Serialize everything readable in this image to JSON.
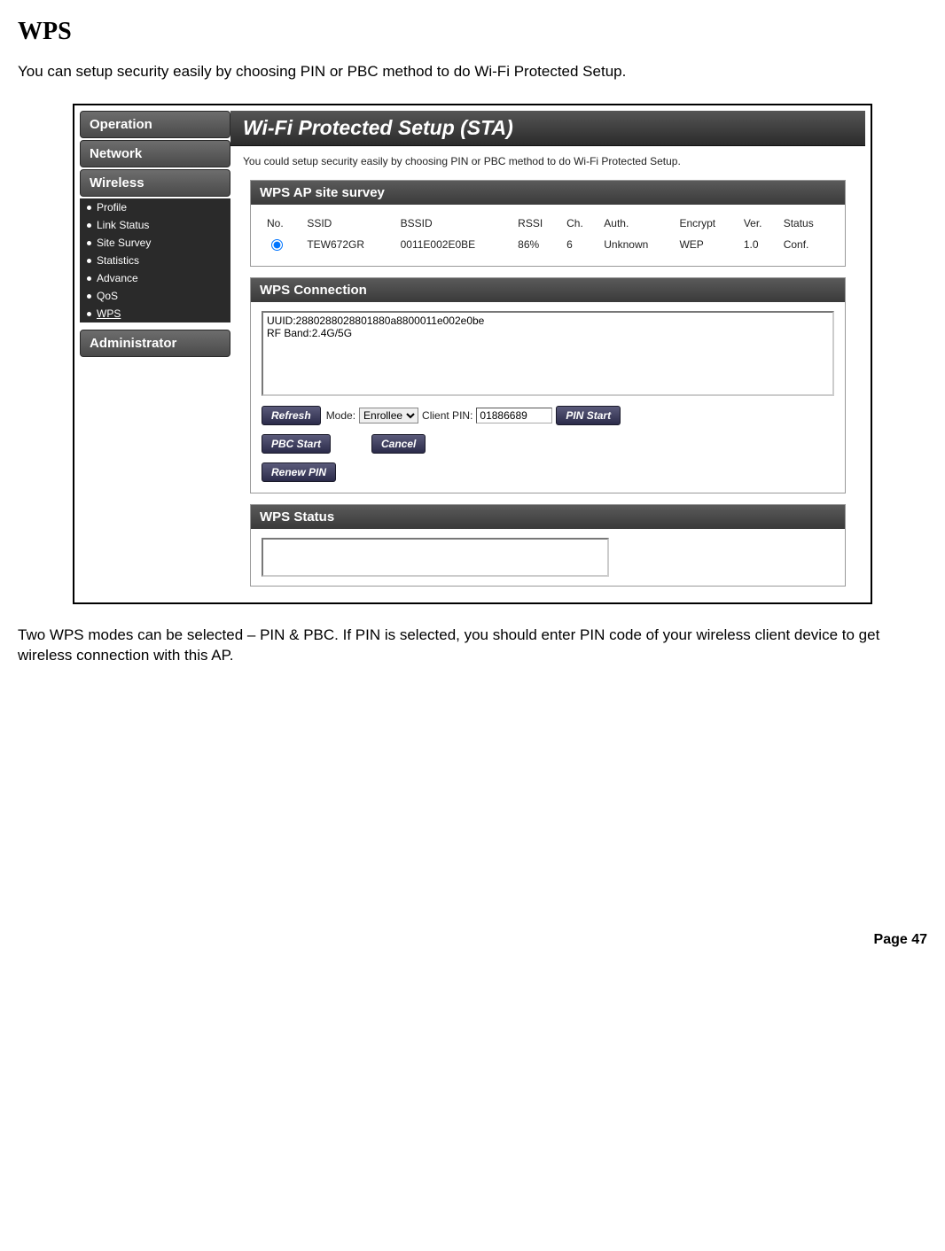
{
  "doc": {
    "heading": "WPS",
    "intro": "You can setup security easily by choosing PIN or PBC method to do Wi-Fi Protected Setup.",
    "outro": "Two WPS modes can be selected – PIN & PBC. If PIN is selected, you should enter PIN code of your wireless client device to get wireless connection with this AP.",
    "page_label": "Page 47"
  },
  "sidebar": {
    "sections": [
      {
        "label": "Operation"
      },
      {
        "label": "Network"
      },
      {
        "label": "Wireless"
      }
    ],
    "wireless_items": [
      {
        "label": "Profile"
      },
      {
        "label": "Link Status"
      },
      {
        "label": "Site Survey"
      },
      {
        "label": "Statistics"
      },
      {
        "label": "Advance"
      },
      {
        "label": "QoS"
      },
      {
        "label": "WPS",
        "active": true
      }
    ],
    "admin": {
      "label": "Administrator"
    }
  },
  "main": {
    "title": "Wi-Fi Protected Setup (STA)",
    "subtitle": "You could setup security easily by choosing PIN or PBC method to do Wi-Fi Protected Setup.",
    "survey": {
      "title": "WPS AP site survey",
      "headers": [
        "No.",
        "SSID",
        "BSSID",
        "RSSI",
        "Ch.",
        "Auth.",
        "Encrypt",
        "Ver.",
        "Status"
      ],
      "row": {
        "no_radio": true,
        "ssid": "TEW672GR",
        "bssid": "0011E002E0BE",
        "rssi": "86%",
        "ch": "6",
        "auth": "Unknown",
        "encrypt": "WEP",
        "ver": "1.0",
        "status": "Conf."
      }
    },
    "connection": {
      "title": "WPS Connection",
      "text": "UUID:2880288028801880a8800011e002e0be\nRF Band:2.4G/5G",
      "refresh": "Refresh",
      "mode_label": "Mode:",
      "mode_value": "Enrollee",
      "pin_label": "Client PIN:",
      "pin_value": "01886689",
      "pin_start": "PIN Start",
      "pbc_start": "PBC Start",
      "cancel": "Cancel",
      "renew_pin": "Renew PIN"
    },
    "status": {
      "title": "WPS Status"
    }
  }
}
